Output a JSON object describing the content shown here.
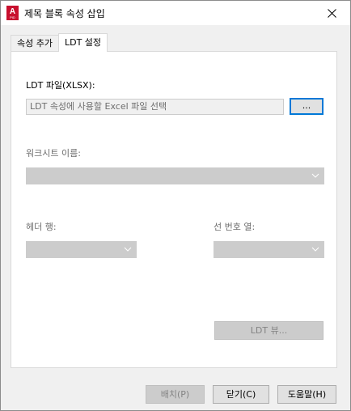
{
  "window": {
    "title": "제목 블록 속성 삽입"
  },
  "tabs": [
    {
      "label": "속성 추가",
      "active": false
    },
    {
      "label": "LDT 설정",
      "active": true
    }
  ],
  "ldt_file": {
    "label": "LDT 파일(XLSX):",
    "placeholder": "LDT 속성에 사용할 Excel 파일 선택",
    "browse_label": "..."
  },
  "worksheet": {
    "label": "워크시트 이름:",
    "value": ""
  },
  "header_row": {
    "label": "헤더 행:",
    "value": ""
  },
  "line_number_column": {
    "label": "선 번호 열:",
    "value": ""
  },
  "ldt_view_button": "LDT 뷰...",
  "footer": {
    "place": "배치(P)",
    "close": "닫기(C)",
    "help": "도움말(H)"
  },
  "colors": {
    "accent": "#0078d7",
    "app_icon": "#c8102e"
  }
}
